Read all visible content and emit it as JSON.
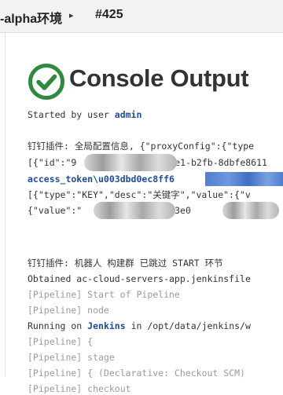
{
  "breadcrumb": {
    "job": "-alpha环境",
    "separator": "▸",
    "build": "#425"
  },
  "page": {
    "title": "Console Output",
    "icon": "success-check-icon",
    "icon_color": "#2e8b3e"
  },
  "console": {
    "started_prefix": "Started by user ",
    "started_user": "admin",
    "lines": {
      "dingtalk_global": "钉钉插件: 全局配置信息, {\"proxyConfig\":{\"type",
      "robots_json": "[{\"id\":\"9",
      "robots_json_tail": "ee1-b2fb-8dbfe8611",
      "access_token": "access_token\\u003dbd0ec8ff6",
      "keywords_json": "[{\"type\":\"KEY\",\"desc\":\"关键字\",\"value\":{\"v",
      "value_json": "{\"value\":\"",
      "value_json_tail": "0d3e0",
      "dingtalk_skip": "钉钉插件: 机器人 构建群 已跳过 START 环节",
      "obtained": "Obtained ac-cloud-servers-app.jenkinsfile",
      "start_pipeline": "[Pipeline] Start of Pipeline",
      "node": "[Pipeline] node",
      "running_prefix": "Running on ",
      "running_host": "Jenkins",
      "running_suffix": " in /opt/data/jenkins/w",
      "brace": "[Pipeline] {",
      "stage": "[Pipeline] stage",
      "declarative": "[Pipeline] { (Declarative: Checkout SCM)",
      "checkout": "[Pipeline] checkout"
    }
  },
  "colors": {
    "link": "#1d4e9a",
    "pipeline_text": "#9a9a9a",
    "success": "#2e8b3e"
  }
}
